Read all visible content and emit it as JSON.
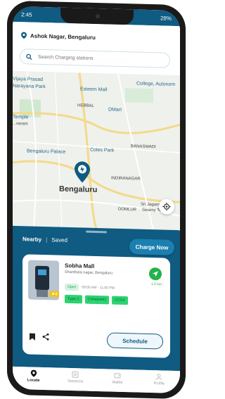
{
  "status": {
    "time": "2:45",
    "battery": "28%"
  },
  "header": {
    "location": "Ashok Nagar, Bengaluru"
  },
  "search": {
    "placeholder": "Search Charging stations"
  },
  "map": {
    "labels": {
      "vijaya": "Vijaya Prasad",
      "narayana": "Narayana Park",
      "esteem": "Esteem Mall",
      "college": "College, Autonom",
      "hebbal": "HEBBAL",
      "dmart": "DMart",
      "temple": "Temple",
      "varam": "...varam",
      "palace": "Bengaluru Palace",
      "coles": "Coles Park",
      "banaswadi": "BANASWADI",
      "indiranagar": "INDIRANAGAR",
      "city": "Bengaluru",
      "domlur": "DOMLUR",
      "sri": "Sri Jagannatha",
      "swamy": "Swamy Temple"
    }
  },
  "sheet": {
    "tab_nearby": "Nearby",
    "tab_saved": "Saved",
    "charge_now": "Charge Now"
  },
  "station": {
    "name": "Sobha Mall",
    "address": "Shanthala nagar, Bengaluru",
    "status": "Open",
    "hours": "09:00 AM - 11:00 PM",
    "rating": "4",
    "distance": "1.5 km",
    "plugs": [
      "Type 2",
      "CHAdeMO",
      "CCS2"
    ],
    "schedule": "Schedule"
  },
  "nav": {
    "locate": "Locate",
    "sessions": "Sessions",
    "wallet": "Wallet",
    "profile": "Profile"
  },
  "colors": {
    "primary": "#0f5b82",
    "accent": "#2dd36f",
    "go": "#23b24b"
  }
}
